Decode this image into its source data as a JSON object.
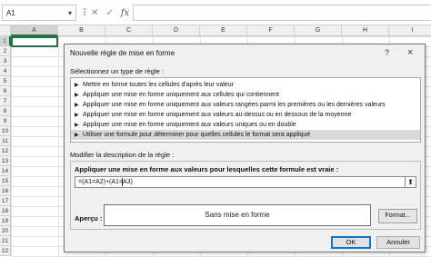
{
  "formula_bar": {
    "namebox_value": "A1",
    "cancel_icon": "x-icon",
    "enter_icon": "check-icon",
    "function_label": "fx"
  },
  "sheet": {
    "columns": [
      "A",
      "B",
      "C",
      "D",
      "E",
      "F",
      "G",
      "H",
      "I"
    ],
    "rows": [
      "1",
      "2",
      "3",
      "4",
      "5",
      "6",
      "7",
      "8",
      "9",
      "10",
      "11",
      "12",
      "13",
      "14",
      "15",
      "16",
      "17",
      "18",
      "19",
      "20",
      "21",
      "22"
    ],
    "active_column": "A",
    "active_row": "1",
    "accent_color": "#217346"
  },
  "dialog": {
    "title": "Nouvelle règle de mise en forme",
    "help": "?",
    "close": "×",
    "select_type_label": "Sélectionnez un type de règle :",
    "rule_types": [
      "Mettre en forme toutes les cellules d'après leur valeur",
      "Appliquer une mise en forme uniquement aux cellules qui contiennent",
      "Appliquer une mise en forme uniquement aux valeurs rangées parmi les premières ou les dernières valeurs",
      "Appliquer une mise en forme uniquement aux valeurs au-dessus ou en dessous de la moyenne",
      "Appliquer une mise en forme uniquement aux valeurs uniques ou en double",
      "Utiliser une formule pour déterminer pour quelles cellules le format sera appliqué"
    ],
    "selected_rule_index": 5,
    "edit_description_label": "Modifier la description de la règle :",
    "formula_label": "Appliquer une mise en forme aux valeurs pour lesquelles cette formule est vraie :",
    "formula_value": "=(A1=A2)+(A1=A3)",
    "preview_label": "Aperçu :",
    "preview_text": "Sans mise en forme",
    "format_button": "Format...",
    "ok_button": "OK",
    "cancel_button": "Annuler",
    "ok_border_color": "#0078d7"
  }
}
